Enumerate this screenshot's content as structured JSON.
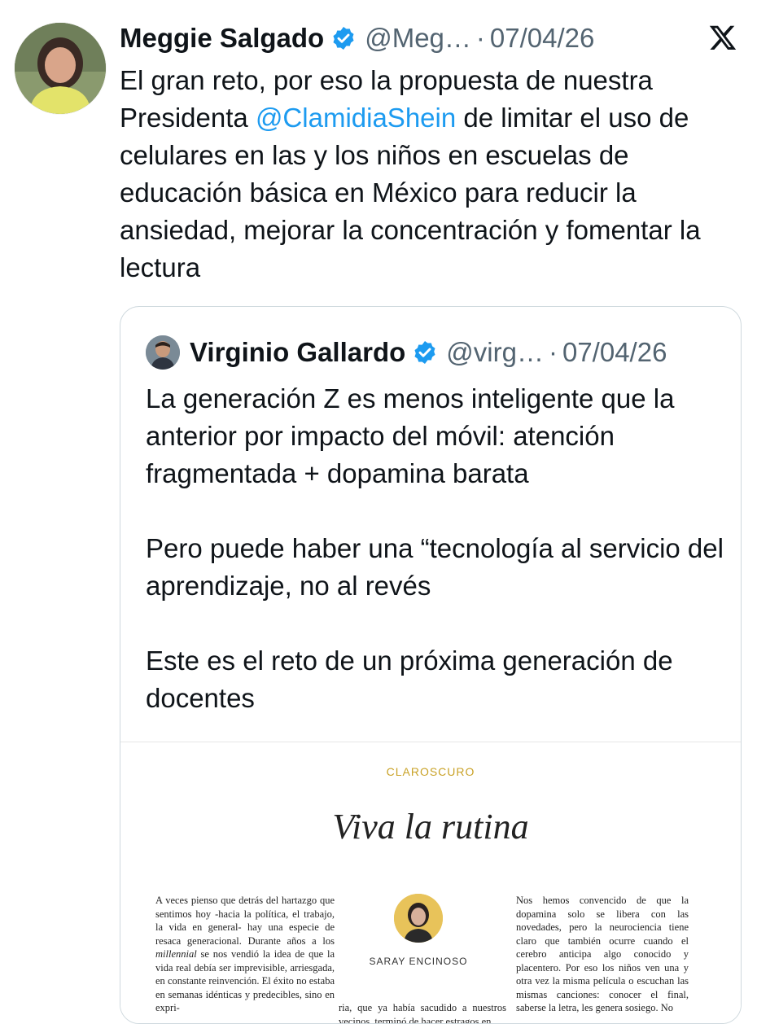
{
  "tweet": {
    "author_name": "Meggie Salgado",
    "handle": "@Meg…",
    "separator": "·",
    "date": "07/04/26",
    "text_before_mention": "El gran reto, por eso la propuesta de nuestra Presidenta ",
    "mention": "@ClamidiaShein",
    "text_after_mention": " de limitar el uso de celulares en las y los niños en escuelas de educación básica en México para reducir la ansiedad, mejorar la concentración y fomentar la lectura"
  },
  "quote": {
    "author_name": "Virginio Gallardo",
    "handle": "@virg…",
    "separator": "·",
    "date": "07/04/26",
    "paragraphs": [
      "La generación Z es menos inteligente que la anterior por impacto del móvil: atención fragmentada + dopamina barata",
      "Pero puede haber una “tecnología al servicio del aprendizaje, no al revés",
      "Este es el reto de un próxima generación de docentes"
    ],
    "article": {
      "kicker": "CLAROSCURO",
      "title": "Viva la rutina",
      "author": "SARAY ENCINOSO",
      "col1_a": "A veces pienso que detrás del hartazgo que sentimos hoy -hacia la política, el trabajo, la vida en general- hay una especie de resaca generacional. Durante años a los ",
      "col1_em": "millennial",
      "col1_b": " se nos vendió la idea de que la vida real debía ser imprevisible, arriesgada, en constante reinvención. El éxito no estaba en semanas idénticas y predecibles, sino en expri-",
      "col2": "ria, que ya había sacudido a nuestros vecinos, terminó de hacer estragos en",
      "col3": "Nos hemos convencido de que la dopamina solo se libera con las novedades, pero la neurociencia tiene claro que también ocurre cuando el cerebro anticipa algo conocido y placentero. Por eso los niños ven una y otra vez la misma película o escuchan las mismas canciones: conocer el final, saberse la letra, les genera sosiego. No"
    }
  },
  "colors": {
    "link": "#1d9bf0",
    "verified": "#1d9bf0",
    "muted": "#536471",
    "kicker": "#c9a227"
  }
}
